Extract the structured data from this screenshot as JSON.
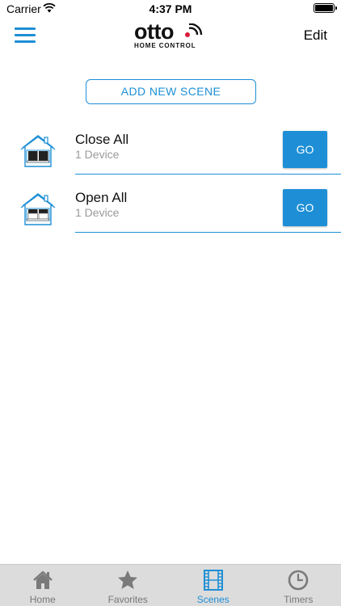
{
  "status_bar": {
    "carrier": "Carrier",
    "time": "4:37 PM"
  },
  "nav": {
    "logo_word": "otto",
    "logo_sub": "HOME CONTROL",
    "edit_label": "Edit"
  },
  "add_scene_label": "ADD NEW SCENE",
  "scenes": [
    {
      "name": "Close All",
      "count": "1 Device",
      "go_label": "GO",
      "icon": "house-closed-shades-icon"
    },
    {
      "name": "Open All",
      "count": "1 Device",
      "go_label": "GO",
      "icon": "house-open-shades-icon"
    }
  ],
  "tabs": [
    {
      "label": "Home",
      "icon": "home-icon"
    },
    {
      "label": "Favorites",
      "icon": "star-icon"
    },
    {
      "label": "Scenes",
      "icon": "film-icon",
      "active": true
    },
    {
      "label": "Timers",
      "icon": "clock-icon"
    }
  ],
  "colors": {
    "accent": "#1e8fd6",
    "logo_dot": "#d81b3a",
    "tab_bar_bg": "#dcdcdc",
    "tab_inactive": "#777777",
    "subtitle_gray": "#9a9a9a"
  }
}
